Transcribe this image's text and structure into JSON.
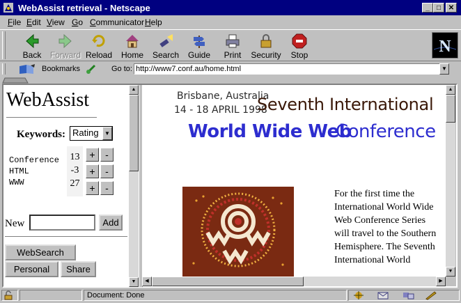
{
  "window": {
    "title": "WebAssist retrieval - Netscape",
    "controls": [
      "_",
      "□",
      "✕"
    ]
  },
  "menu": [
    "File",
    "Edit",
    "View",
    "Go",
    "Communicator",
    "Help"
  ],
  "toolbar": {
    "back": "Back",
    "forward": "Forward",
    "reload": "Reload",
    "home": "Home",
    "search": "Search",
    "guide": "Guide",
    "print": "Print",
    "security": "Security",
    "stop": "Stop"
  },
  "location": {
    "bookmarks": "Bookmarks",
    "goto_label": "Go to:",
    "url": "http://www7.conf.au/home.html"
  },
  "webassist": {
    "title": "WebAssist",
    "keywords_label": "Keywords:",
    "sort_select": "Rating",
    "keywords": [
      {
        "term": "Conference",
        "score": "13"
      },
      {
        "term": "HTML",
        "score": "-3"
      },
      {
        "term": "WWW",
        "score": "27"
      }
    ],
    "plus": "+",
    "minus": "-",
    "new_label": "New",
    "new_value": "",
    "add_button": "Add",
    "websearch_button": "WebSearch",
    "personal_button": "Personal",
    "share_button": "Share"
  },
  "conference": {
    "location": "Brisbane, Australia",
    "dates": "14 - 18 APRIL 1998",
    "heading1": "Seventh International",
    "heading2a": "World Wide Web",
    "heading2b": "Conference",
    "body": "For the first time the International World Wide Web Conference Series will travel to the Southern Hemisphere. The Seventh International World",
    "logo_icon": "www7-aboriginal-dot-art-logo-icon"
  },
  "status": {
    "text": "Document: Done"
  },
  "colors": {
    "titlebar": "#000080",
    "conference_blue": "#2d2dcf",
    "logo_bg": "#7a2a12"
  }
}
